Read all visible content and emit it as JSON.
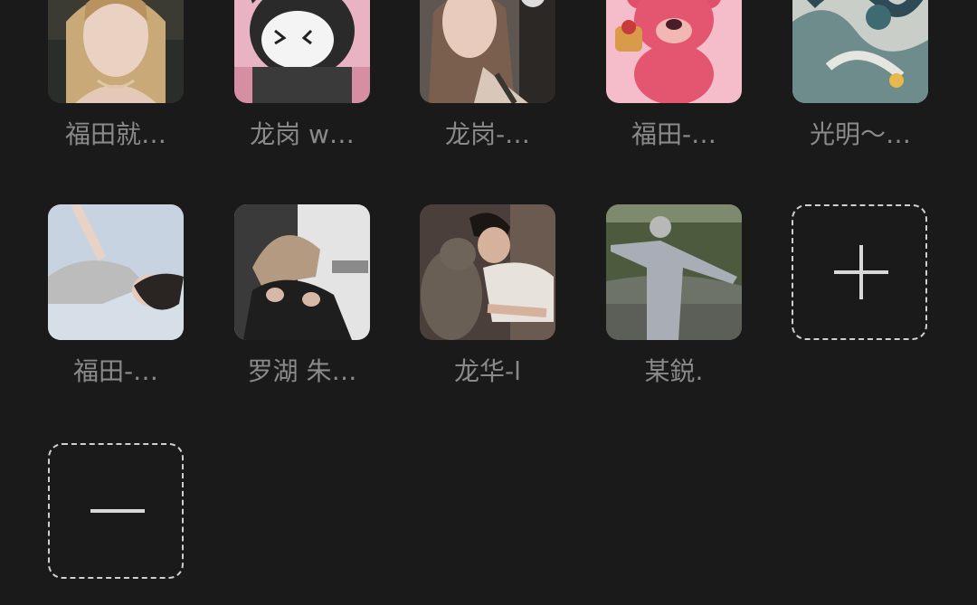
{
  "members": [
    {
      "name": "福田就…",
      "avatar_icon": "avatar-photo-woman-blonde"
    },
    {
      "name": "龙岗 w…",
      "avatar_icon": "avatar-cartoon-kuromi"
    },
    {
      "name": "龙岗-…",
      "avatar_icon": "avatar-photo-woman"
    },
    {
      "name": "福田-…",
      "avatar_icon": "avatar-cartoon-lotso-bear"
    },
    {
      "name": "光明～…",
      "avatar_icon": "avatar-art-dragon"
    },
    {
      "name": "福田-…",
      "avatar_icon": "avatar-photo-woman-lying"
    },
    {
      "name": "罗湖 朱…",
      "avatar_icon": "avatar-photo-man-blond"
    },
    {
      "name": "龙华-l",
      "avatar_icon": "avatar-photo-man-cat"
    },
    {
      "name": "某鋭.",
      "avatar_icon": "avatar-photo-person-field"
    }
  ],
  "controls": {
    "add_icon": "plus-icon",
    "remove_icon": "minus-icon"
  },
  "colors": {
    "background": "#1a1a1a",
    "name_text": "#8a8a8a",
    "dashed_border": "#cfcfcf"
  }
}
